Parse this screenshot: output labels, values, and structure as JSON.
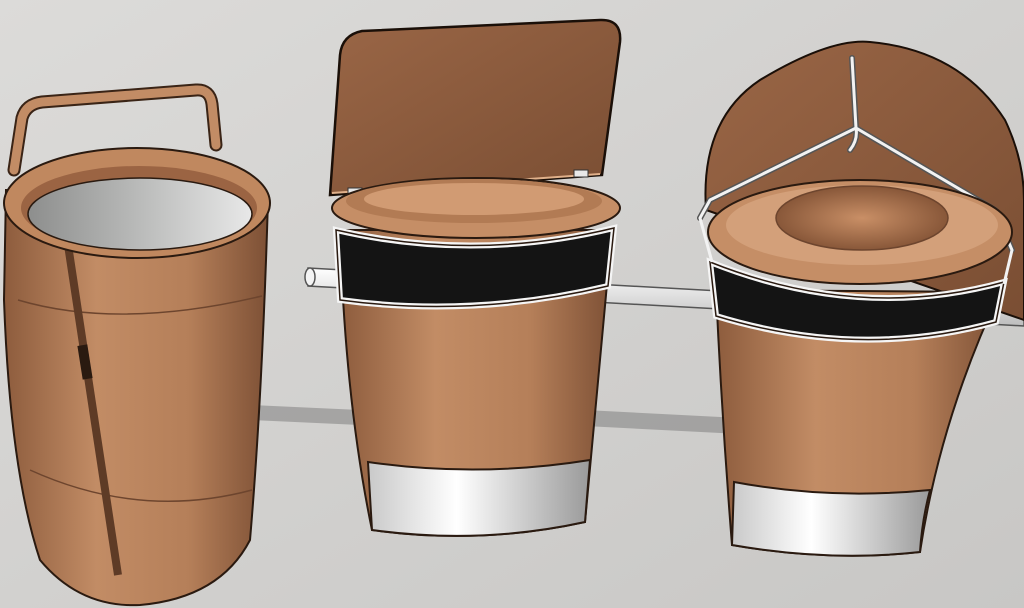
{
  "scene": {
    "background": "#d4d3d1",
    "colors": {
      "body": "#bb8761",
      "body_dark": "#8a5a3c",
      "body_light": "#d49c74",
      "band": "#141414",
      "trim": "#f2f2f2",
      "rod": "#e6e6e6",
      "interior_gray": "#a9aaa9",
      "outline": "#2a1a10"
    },
    "objects": [
      {
        "name": "tall-bucket-with-handle"
      },
      {
        "name": "bucket-with-flip-lid"
      },
      {
        "name": "bucket-with-seat-and-wire-frame"
      }
    ]
  }
}
